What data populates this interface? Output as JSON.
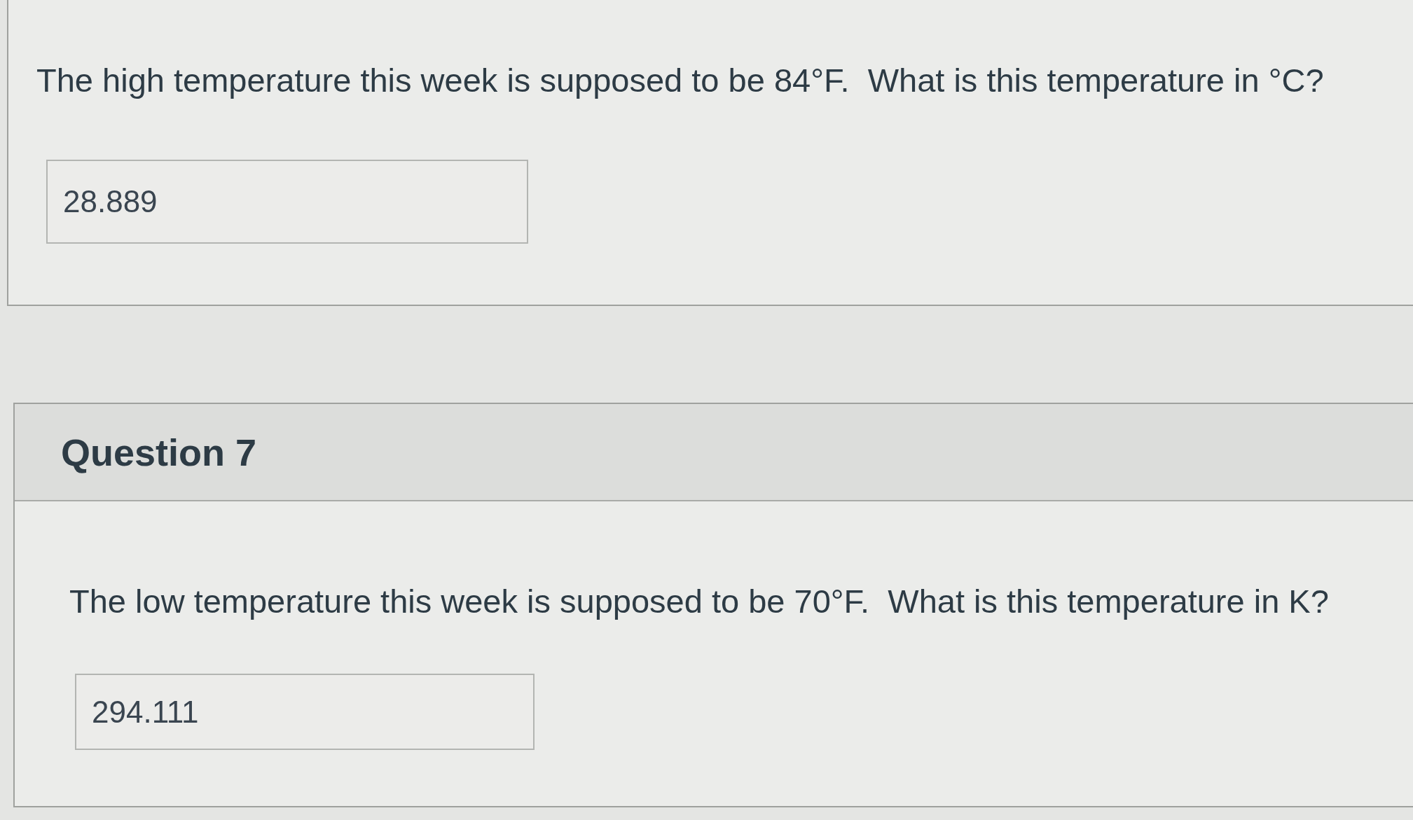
{
  "questions": [
    {
      "prompt": "The high temperature this week is supposed to be 84°F.  What is this temperature in °C?",
      "answer": {
        "value": "28.889"
      }
    },
    {
      "title": "Question 7",
      "prompt": "The low temperature this week is supposed to be 70°F.  What is this temperature in K?",
      "answer": {
        "value": "294.111"
      }
    }
  ]
}
